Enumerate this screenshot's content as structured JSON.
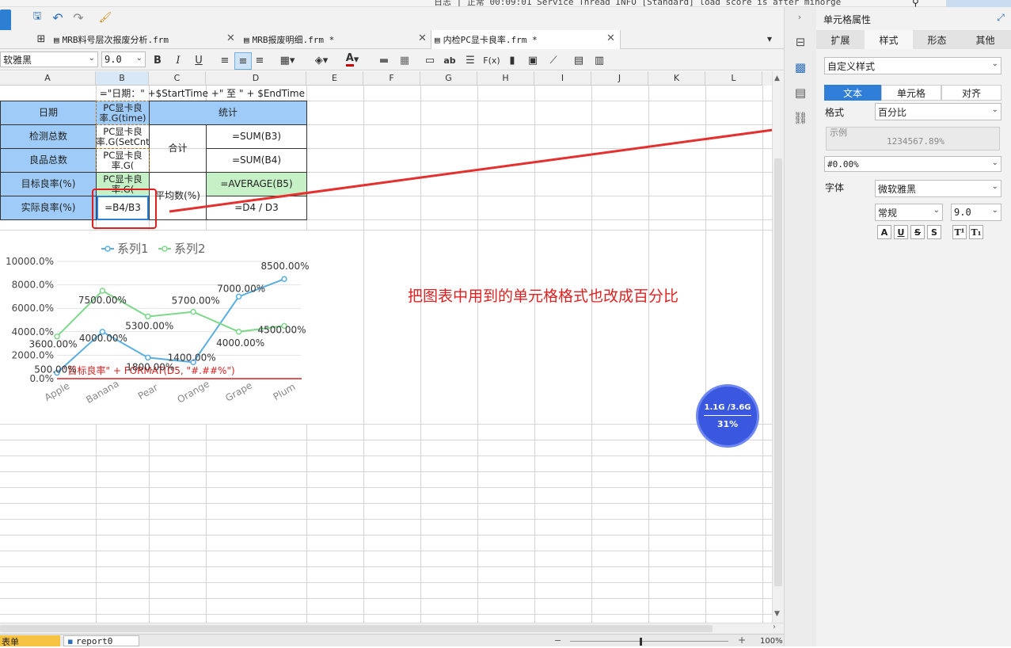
{
  "title_strip": "日志 | 正常 00:09:01 Service Thread INFO [Standard] load score is after minorge",
  "toolbar": {
    "font_name": "软雅黑",
    "font_size": "9.0"
  },
  "tabs": [
    {
      "label": "MRB料号层次报废分析.frm"
    },
    {
      "label": "MRB报废明细.frm *"
    },
    {
      "label": "内检PC显卡良率.frm *"
    }
  ],
  "columns": [
    "A",
    "B",
    "C",
    "D",
    "E",
    "F",
    "G",
    "H",
    "I",
    "J",
    "K",
    "L"
  ],
  "sheet": {
    "header_formula": "=\"日期：\" +$StartTime +\" 至 \" + $EndTime",
    "a2": "日期",
    "b2": "PC显卡良率.G(time)",
    "cd2": "统计",
    "a3": "检测总数",
    "b3": "PC显卡良率.G(SetCnt",
    "c34": "合计",
    "d3": "=SUM(B3)",
    "a4": "良品总数",
    "b4": "PC显卡良率.G(",
    "d4": "=SUM(B4)",
    "a5": "目标良率(%)",
    "b5": "PC显卡良率.G(",
    "c56": "平均数(%)",
    "d5": "=AVERAGE(B5)",
    "a6": "实际良率(%)",
    "b6": "=B4/B3",
    "d6": "=D4 / D3"
  },
  "chart_data": {
    "type": "line",
    "categories": [
      "Apple",
      "Banana",
      "Pear",
      "Orange",
      "Grape",
      "Plum"
    ],
    "series": [
      {
        "name": "系列1",
        "values": [
          500,
          4000,
          1800,
          1400,
          7000,
          8500
        ],
        "color": "#5aaee0"
      },
      {
        "name": "系列2",
        "values": [
          3600,
          7500,
          5300,
          5700,
          4000,
          4500
        ],
        "color": "#7dd88a"
      }
    ],
    "value_labels": [
      "500.00%",
      "4000.00%",
      "1800.00%",
      "1400.00%",
      "7000.00%",
      "8500.00%",
      "3600.00%",
      "7500.00%",
      "5300.00%",
      "5700.00%",
      "4000.00%",
      "4500.00%"
    ],
    "y_ticks": [
      "0.0%",
      "2000.0%",
      "4000.0%",
      "6000.0%",
      "8000.0%",
      "10000.0%"
    ],
    "ylim": [
      0,
      10000
    ],
    "legend_position": "top",
    "grid": true,
    "target_line_label": "\"目标良率\" + FORMAT(D5, \"#.##%\")"
  },
  "annotation_text": "把图表中用到的单元格格式也改成百分比",
  "memory_widget": {
    "usage": "1.1G /3.6G",
    "percent": "31%"
  },
  "right_panel": {
    "title": "单元格属性",
    "tabs": [
      "扩展",
      "样式",
      "形态",
      "其他"
    ],
    "style_select": "自定义样式",
    "subtabs": [
      "文本",
      "单元格",
      "对齐"
    ],
    "format_label": "格式",
    "format_value": "百分比",
    "example_label": "示例",
    "example_value": "1234567.89%",
    "pattern_value": "#0.00%",
    "font_label": "字体",
    "font_family": "微软雅黑",
    "font_style": "常规",
    "font_size": "9.0"
  },
  "bottom": {
    "sheet_tabs": [
      "表单",
      "report0"
    ],
    "zoom": "100%"
  }
}
